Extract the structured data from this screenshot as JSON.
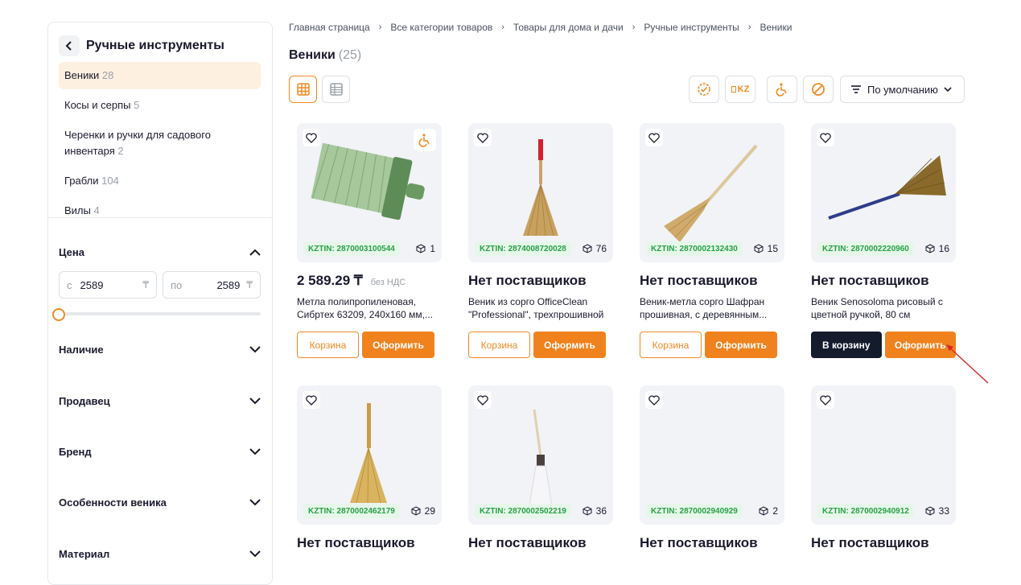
{
  "sidebar": {
    "title": "Ручные инструменты",
    "categories": [
      {
        "label": "Веники",
        "count": "28",
        "active": true
      },
      {
        "label": "Косы и серпы",
        "count": "5"
      },
      {
        "label": "Черенки и ручки для садового инвентаря",
        "count": "2"
      },
      {
        "label": "Грабли",
        "count": "104"
      },
      {
        "label": "Вилы",
        "count": "4"
      }
    ],
    "filters": {
      "price": "Цена",
      "availability": "Наличие",
      "seller": "Продавец",
      "brand": "Бренд",
      "features": "Особенности веника",
      "material": "Материал"
    },
    "price_from_prefix": "с",
    "price_from": "2589",
    "price_to_prefix": "по",
    "price_to": "2589",
    "currency": "₸",
    "slider_level": 0
  },
  "breadcrumb": [
    "Главная страница",
    "Все категории товаров",
    "Товары для дома и дачи",
    "Ручные инструменты",
    "Веники"
  ],
  "page": {
    "title": "Веники",
    "count": "(25)"
  },
  "toolbar": {
    "kz_label": "KZ",
    "sort_label": "По умолчанию"
  },
  "products": [
    {
      "kztin": "KZTIN: 2870003100544",
      "stock": "1",
      "price": "2 589.29 ₸",
      "vat": "без НДС",
      "desc": "Метла полипропиленовая, Сибртех 63209, 240x160 мм,...",
      "cart": "Корзина",
      "order": "Оформить"
    },
    {
      "kztin": "KZTIN: 2874008720028",
      "stock": "76",
      "price": "Нет поставщиков",
      "desc": "Веник из сорго OfficeClean \"Professional\", трехпрошивной",
      "cart": "Корзина",
      "order": "Оформить"
    },
    {
      "kztin": "KZTIN: 2870002132430",
      "stock": "15",
      "price": "Нет поставщиков",
      "desc": "Веник-метла сорго Шафран прошивная, с деревянным...",
      "cart": "Корзина",
      "order": "Оформить"
    },
    {
      "kztin": "KZTIN: 2870002220960",
      "stock": "16",
      "price": "Нет поставщиков",
      "desc": "Веник Senosoloma рисовый с цветной ручкой, 80 см",
      "cart": "В корзину",
      "order": "Оформить"
    },
    {
      "kztin": "KZTIN: 2870002462179",
      "stock": "29",
      "price": "Нет поставщиков"
    },
    {
      "kztin": "KZTIN: 2870002502219",
      "stock": "36",
      "price": "Нет поставщиков"
    },
    {
      "kztin": "KZTIN: 2870002940929",
      "stock": "2",
      "price": "Нет поставщиков"
    },
    {
      "kztin": "KZTIN: 2870002940912",
      "stock": "33",
      "price": "Нет поставщиков"
    }
  ],
  "colors": {
    "accent": "#f08a24",
    "dark_button": "#141b2d",
    "kztin_green": "#29a047"
  }
}
